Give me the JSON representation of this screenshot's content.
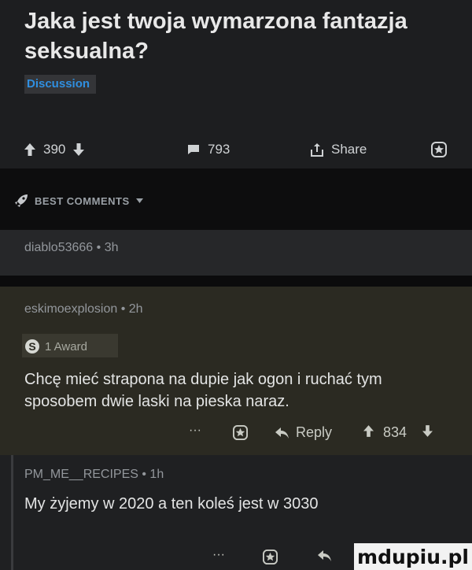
{
  "post": {
    "title": "Jaka jest twoja wymarzona fantazja seksualna?",
    "flair": "Discussion",
    "upvotes": "390",
    "comments": "793",
    "share_label": "Share"
  },
  "comments_bar": {
    "label": "BEST COMMENTS"
  },
  "comments": [
    {
      "author_meta": "diablo53666 • 3h"
    },
    {
      "author_meta": "eskimoexplosion • 2h",
      "award": "1 Award",
      "body": "Chcę mieć strapona na dupie jak ogon i ruchać tym sposobem dwie laski na pieska naraz.",
      "more": "···",
      "reply_label": "Reply",
      "score": "834"
    },
    {
      "author_meta": "PM_ME__RECIPES • 1h",
      "body": "My żyjemy w 2020 a ten koleś jest w 3030",
      "more": "···"
    }
  ],
  "watermark": "mdupiu.pl",
  "colors": {
    "background": "#1d1e20",
    "flair_text": "#2f8fe0",
    "highlight_comment": "#2b2a22"
  }
}
